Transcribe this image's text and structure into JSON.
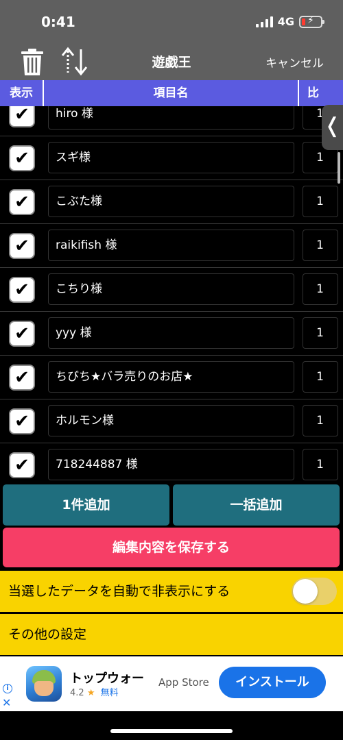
{
  "status_bar": {
    "time": "0:41",
    "network": "4G"
  },
  "nav": {
    "title": "遊戯王",
    "cancel_label": "キャンセル"
  },
  "columns": {
    "show": "表示",
    "name": "項目名",
    "ratio": "比"
  },
  "items": [
    {
      "checked": true,
      "check_mark": "✔",
      "name": "hiro 様",
      "ratio": "1"
    },
    {
      "checked": true,
      "check_mark": "✔",
      "name": "スギ様",
      "ratio": "1"
    },
    {
      "checked": true,
      "check_mark": "✔",
      "name": "こぶた様",
      "ratio": "1"
    },
    {
      "checked": true,
      "check_mark": "✔",
      "name": "raikifish 様",
      "ratio": "1"
    },
    {
      "checked": true,
      "check_mark": "✔",
      "name": "こちり様",
      "ratio": "1"
    },
    {
      "checked": true,
      "check_mark": "✔",
      "name": "yyy 様",
      "ratio": "1"
    },
    {
      "checked": true,
      "check_mark": "✔",
      "name": "ちびち★バラ売りのお店★",
      "ratio": "1"
    },
    {
      "checked": true,
      "check_mark": "✔",
      "name": "ホルモン様",
      "ratio": "1"
    },
    {
      "checked": true,
      "check_mark": "✔",
      "name": "718244887 様",
      "ratio": "1"
    }
  ],
  "side_handle_glyph": "❬",
  "buttons": {
    "add_one": "1件追加",
    "add_bulk": "一括追加",
    "save": "編集内容を保存する"
  },
  "settings": {
    "auto_hide_label": "当選したデータを自動で非表示にする",
    "auto_hide_enabled": false,
    "other_label": "その他の設定"
  },
  "ad": {
    "info_glyph": "i",
    "close_glyph": "✕",
    "title": "トップウォー",
    "rating": "4.2",
    "star": "★",
    "price": "無料",
    "store": "App Store",
    "install_label": "インストール"
  },
  "colors": {
    "header_bar": "#5f5f5f",
    "column_header": "#5b5be0",
    "add_button": "#1f6e7e",
    "save_button": "#f63e66",
    "settings_row": "#f9d300",
    "install_button": "#1a73e8"
  },
  "icons": [
    "trash-icon",
    "sort-icon",
    "signal-icon",
    "battery-icon",
    "chevron-left-icon",
    "check-icon"
  ]
}
